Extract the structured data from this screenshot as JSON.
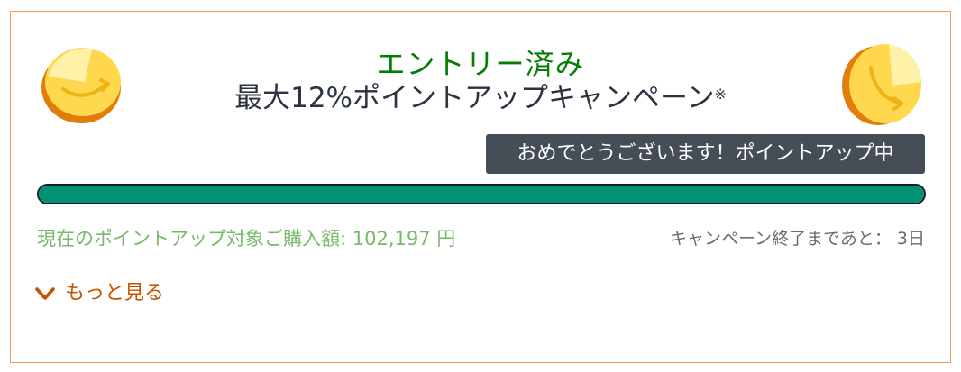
{
  "status": {
    "entry_label": "エントリー済み"
  },
  "campaign": {
    "title": "最大12%ポイントアップキャンペーン",
    "note_mark": "※"
  },
  "toast": {
    "message": "おめでとうございます！ポイントアップ中"
  },
  "progress": {
    "percent_complete": 100,
    "fill_color": "#009272"
  },
  "purchase": {
    "label": "現在のポイントアップ対象ご購入額:",
    "amount": "102,197 円"
  },
  "remaining": {
    "label": "キャンペーン終了まであと：",
    "days": "3日"
  },
  "more": {
    "label": "もっと見る",
    "icon": "chevron-down-icon"
  },
  "icons": {
    "left_coin": "coin-icon",
    "right_coin": "coin-icon"
  },
  "colors": {
    "border": "#e8a052",
    "status_green": "#067d06",
    "amount_green": "#78b96a",
    "link_orange": "#c45500",
    "toast_bg": "#454d56"
  }
}
